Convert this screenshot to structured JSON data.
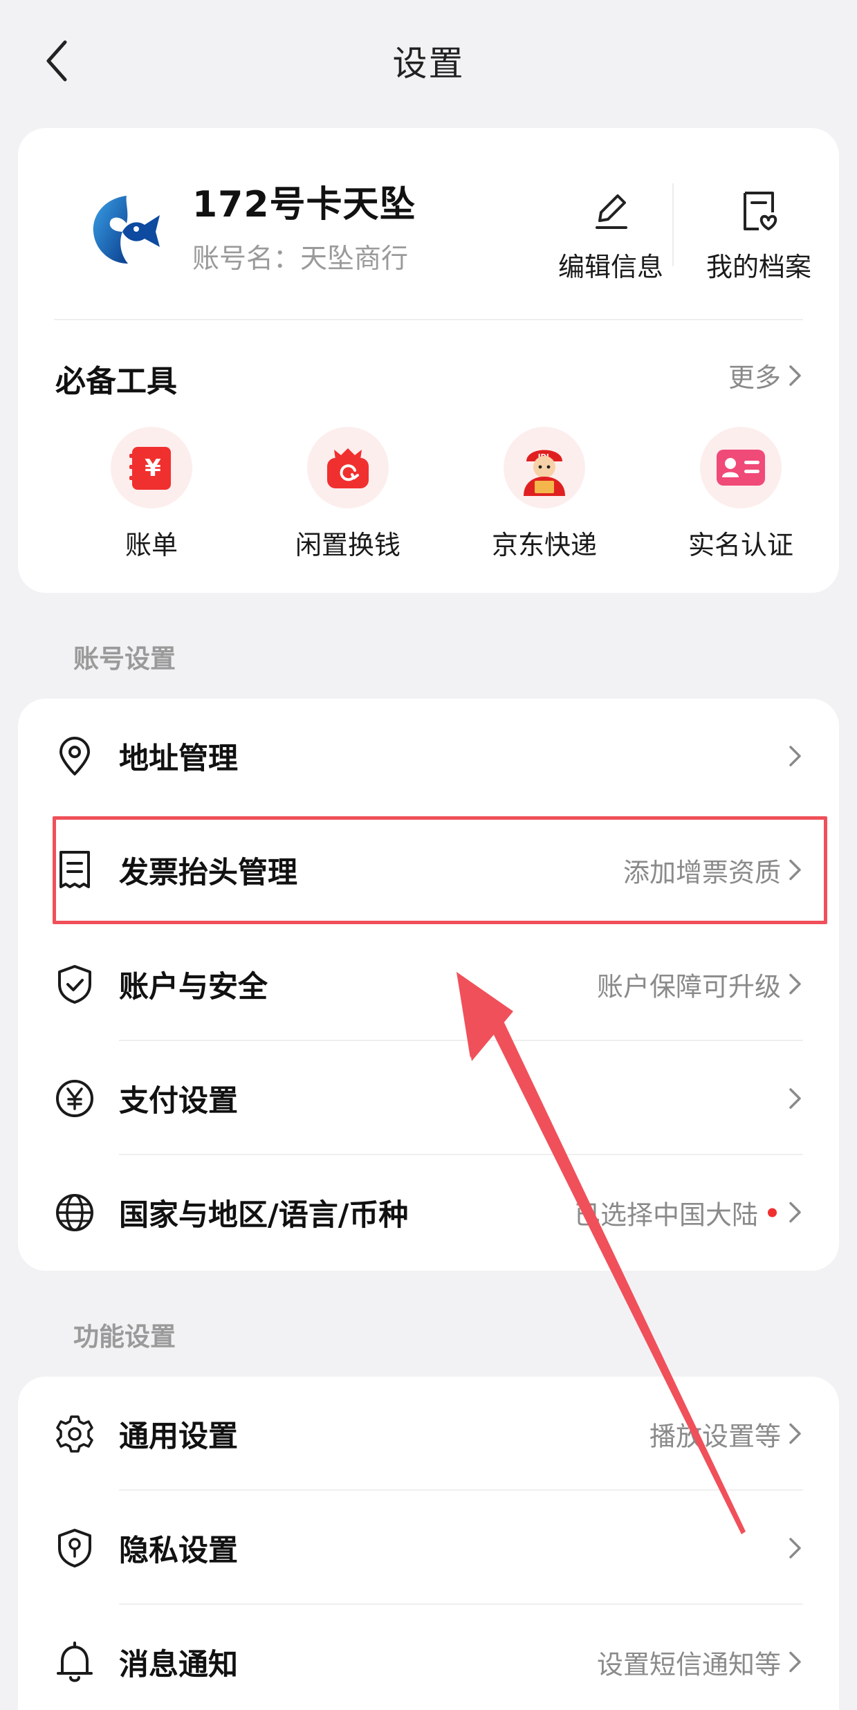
{
  "header": {
    "title": "设置",
    "back_icon": "chevron-left-icon"
  },
  "profile": {
    "nickname": "172号卡天坠",
    "account_label": "账号名：",
    "account_name": "天坠商行",
    "edit_label": "编辑信息",
    "archive_label": "我的档案"
  },
  "tools": {
    "title": "必备工具",
    "more_label": "更多",
    "items": [
      {
        "label": "账单",
        "icon": "bill-icon"
      },
      {
        "label": "闲置换钱",
        "icon": "recycle-bag-icon"
      },
      {
        "label": "京东快递",
        "icon": "courier-mascot-icon"
      },
      {
        "label": "实名认证",
        "icon": "id-card-icon"
      }
    ]
  },
  "account_settings": {
    "section_label": "账号设置",
    "rows": [
      {
        "title": "地址管理",
        "value": "",
        "icon": "location-pin-icon"
      },
      {
        "title": "发票抬头管理",
        "value": "添加增票资质",
        "icon": "receipt-icon"
      },
      {
        "title": "账户与安全",
        "value": "账户保障可升级",
        "icon": "shield-check-icon"
      },
      {
        "title": "支付设置",
        "value": "",
        "icon": "yuan-circle-icon"
      },
      {
        "title": "国家与地区/语言/币种",
        "value": "已选择中国大陆",
        "icon": "globe-icon"
      }
    ]
  },
  "function_settings": {
    "section_label": "功能设置",
    "rows": [
      {
        "title": "通用设置",
        "value": "播放设置等",
        "icon": "gear-icon"
      },
      {
        "title": "隐私设置",
        "value": "",
        "icon": "privacy-shield-icon"
      },
      {
        "title": "消息通知",
        "value": "设置短信通知等",
        "icon": "bell-icon"
      }
    ]
  },
  "colors": {
    "accent_red": "#f0302f",
    "annotation_red": "#f0505a",
    "background": "#f2f2f4"
  }
}
